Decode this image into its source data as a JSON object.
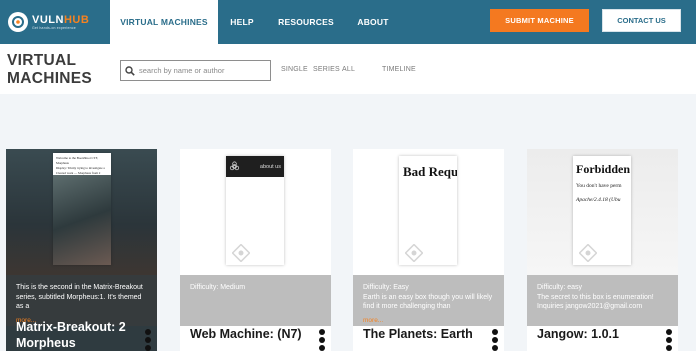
{
  "nav": {
    "logo": {
      "name_a": "VULN",
      "name_b": "HUB",
      "tagline": "Get hands-on experience"
    },
    "items": [
      {
        "label": "VIRTUAL MACHINES"
      },
      {
        "label": "HELP"
      },
      {
        "label": "RESOURCES"
      },
      {
        "label": "ABOUT"
      }
    ],
    "submit_label": "SUBMIT MACHINE",
    "contact_label": "CONTACT US"
  },
  "header": {
    "title_line1": "VIRTUAL",
    "title_line2": "MACHINES",
    "search_placeholder": "search by name or author",
    "filters": [
      "SINGLE",
      "SERIES",
      "ALL",
      "TIMELINE"
    ]
  },
  "cards": [
    {
      "title": "Matrix-Breakout: 2 Morpheus",
      "description": "This is the second in the Matrix-Breakout series, subtitled Morpheus:1. It's themed as a",
      "more": "more...",
      "shot_lines": [
        "Welcome to the Boot2Root CTF, Morpheus",
        "Display: Trinity trying to investigate a",
        "Cleared work — Morpheus from 2 legends"
      ]
    },
    {
      "title": "Web Machine: (N7)",
      "description": "Difficulty: Medium",
      "shot_header": "about us"
    },
    {
      "title": "The Planets: Earth",
      "description": "Difficulty: Easy\nEarth is an easy box though you will likely find it more challenging than",
      "more": "more...",
      "shot_text": "Bad Requ"
    },
    {
      "title": "Jangow: 1.0.1",
      "description": "Difficulty: easy\nThe secret to this box is enumeration! Inquiries jangow2021@gmail.com",
      "shot_title": "Forbidden",
      "shot_line1": "You don't have perm",
      "shot_line2": "Apache/2.4.18 (Ubu"
    }
  ],
  "colors": {
    "nav_bg": "#2a6d8a",
    "accent": "#f47920",
    "content_bg": "#f2f5f8",
    "desc_bg": "#bdbdbd"
  }
}
